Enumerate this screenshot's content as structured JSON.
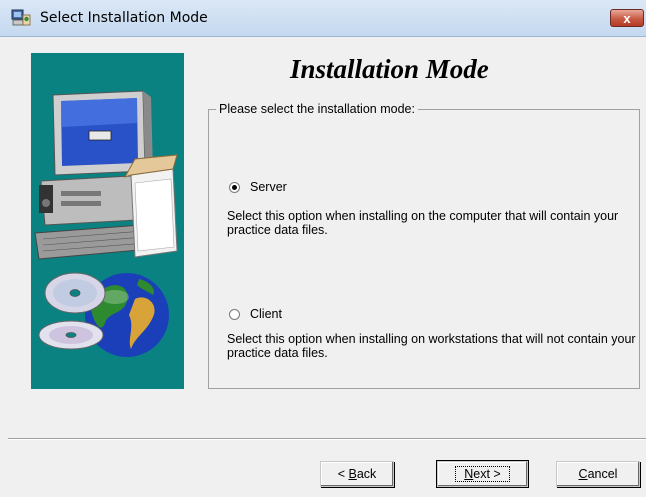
{
  "window": {
    "title": "Select Installation Mode",
    "close_label": "x"
  },
  "heading": "Installation Mode",
  "group": {
    "legend": "Please select the installation mode:"
  },
  "options": [
    {
      "label": "Server",
      "selected": true,
      "description": "Select this option when installing on the computer that will contain your practice data files."
    },
    {
      "label": "Client",
      "selected": false,
      "description": "Select this option when installing on workstations that will not contain your practice data files."
    }
  ],
  "buttons": {
    "back": {
      "prefix": "< ",
      "mnemonic": "B",
      "rest": "ack"
    },
    "next": {
      "mnemonic": "N",
      "rest": "ext >"
    },
    "cancel": {
      "mnemonic": "C",
      "rest": "ancel"
    }
  },
  "colors": {
    "illustration_background": "#0a8282",
    "titlebar": "#c4d8ef",
    "close_button": "#c85a43"
  }
}
